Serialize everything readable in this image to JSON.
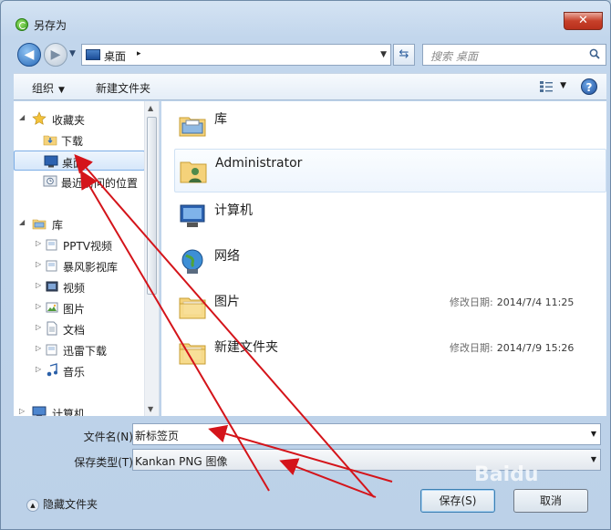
{
  "window": {
    "title": "另存为",
    "close_label": "✕"
  },
  "address_bar": {
    "path": "桌面",
    "separator": "▸",
    "search_placeholder": "搜索 桌面"
  },
  "toolbar": {
    "organize_label": "组织",
    "new_folder_label": "新建文件夹",
    "help_label": "?"
  },
  "nav": {
    "items": [
      {
        "label": "收藏夹",
        "icon": "star-icon",
        "level": 0,
        "expanded": true
      },
      {
        "label": "下载",
        "icon": "download-folder-icon",
        "level": 1
      },
      {
        "label": "桌面",
        "icon": "desktop-icon",
        "level": 1,
        "selected": true
      },
      {
        "label": "最近访问的位置",
        "icon": "recent-places-icon",
        "level": 1
      },
      {
        "label": "库",
        "icon": "library-icon",
        "level": 0,
        "expanded": true
      },
      {
        "label": "PPTV视频",
        "icon": "library-folder-icon",
        "level": 1
      },
      {
        "label": "暴风影视库",
        "icon": "library-folder-icon",
        "level": 1
      },
      {
        "label": "视频",
        "icon": "video-library-icon",
        "level": 1
      },
      {
        "label": "图片",
        "icon": "picture-library-icon",
        "level": 1
      },
      {
        "label": "文档",
        "icon": "document-library-icon",
        "level": 1
      },
      {
        "label": "迅雷下载",
        "icon": "library-folder-icon",
        "level": 1
      },
      {
        "label": "音乐",
        "icon": "music-library-icon",
        "level": 1
      },
      {
        "label": "计算机",
        "icon": "computer-icon",
        "level": 0
      }
    ]
  },
  "files": [
    {
      "name": "库",
      "icon": "library-icon",
      "meta_label": "",
      "meta_value": ""
    },
    {
      "name": "Administrator",
      "icon": "user-folder-icon",
      "meta_label": "",
      "meta_value": "",
      "hover": true
    },
    {
      "name": "计算机",
      "icon": "computer-icon",
      "meta_label": "",
      "meta_value": ""
    },
    {
      "name": "网络",
      "icon": "network-icon",
      "meta_label": "",
      "meta_value": ""
    },
    {
      "name": "图片",
      "icon": "folder-icon",
      "meta_label": "修改日期:",
      "meta_value": "2014/7/4 11:25"
    },
    {
      "name": "新建文件夹",
      "icon": "folder-icon",
      "meta_label": "修改日期:",
      "meta_value": "2014/7/9 15:26"
    }
  ],
  "form": {
    "filename_label": "文件名(N):",
    "filename_value": "新标签页",
    "filetype_label": "保存类型(T):",
    "filetype_value": "Kankan PNG 图像"
  },
  "footer": {
    "hide_folders_label": "隐藏文件夹",
    "save_label": "保存(S)",
    "cancel_label": "取消"
  },
  "watermark": "Baidu",
  "colors": {
    "annotation_arrow": "#d4141a",
    "selection": "#7daee6",
    "accent": "#2667b6"
  }
}
